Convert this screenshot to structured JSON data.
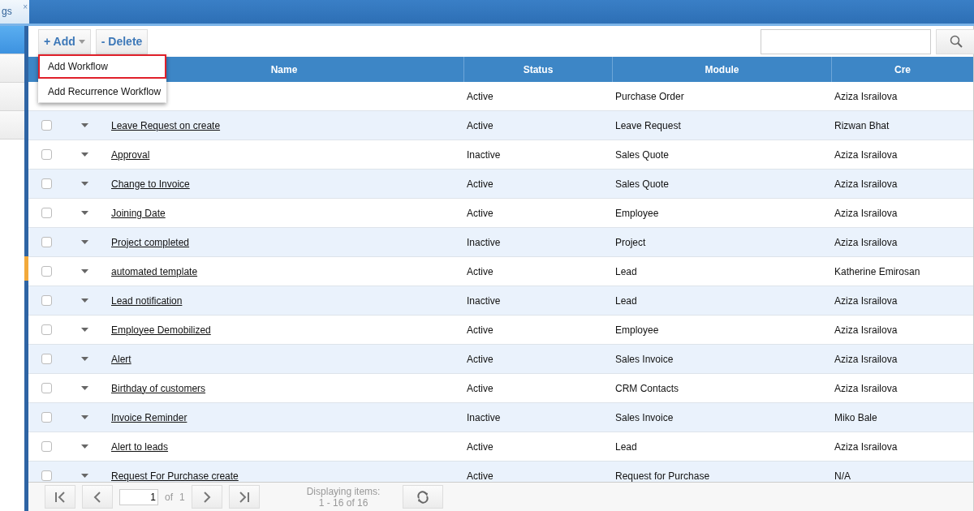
{
  "tab": {
    "label": "gs",
    "close": "×"
  },
  "sidebar": {
    "items": [
      {
        "selected": true
      },
      {
        "selected": false
      },
      {
        "selected": false
      },
      {
        "selected": false
      }
    ]
  },
  "toolbar": {
    "add": "+ Add",
    "delete": "- Delete"
  },
  "menu": [
    {
      "label": "Add Workflow",
      "highlighted": true
    },
    {
      "label": "Add Recurrence Workflow",
      "highlighted": false
    }
  ],
  "table": {
    "columns": [
      "Name",
      "Status",
      "Module",
      "Cre"
    ],
    "rows": [
      {
        "status": "Active",
        "module": "Purchase Order",
        "creator": "Aziza Israilova"
      },
      {
        "name": "Leave Request on create",
        "status": "Active",
        "module": "Leave Request",
        "creator": "Rizwan Bhat",
        "checked": false
      },
      {
        "name": "Approval",
        "status": "Inactive",
        "module": "Sales Quote",
        "creator": "Aziza Israilova",
        "checked": false
      },
      {
        "name": "Change to Invoice",
        "status": "Active",
        "module": "Sales Quote",
        "creator": "Aziza Israilova",
        "checked": false
      },
      {
        "name": "Joining Date",
        "status": "Active",
        "module": "Employee",
        "creator": "Aziza Israilova",
        "checked": false
      },
      {
        "name": "Project completed",
        "status": "Inactive",
        "module": "Project",
        "creator": "Aziza Israilova",
        "checked": false
      },
      {
        "name": "automated template",
        "status": "Active",
        "module": "Lead",
        "creator": "Katherine Emirosan",
        "checked": false
      },
      {
        "name": "Lead notification",
        "status": "Inactive",
        "module": "Lead",
        "creator": "Aziza Israilova",
        "checked": false
      },
      {
        "name": "Employee Demobilized",
        "status": "Active",
        "module": "Employee",
        "creator": "Aziza Israilova",
        "checked": false
      },
      {
        "name": "Alert",
        "status": "Active",
        "module": "Sales Invoice",
        "creator": "Aziza Israilova",
        "checked": false
      },
      {
        "name": "Birthday of customers",
        "status": "Active",
        "module": "CRM Contacts",
        "creator": "Aziza Israilova",
        "checked": false
      },
      {
        "name": "Invoice Reminder",
        "status": "Inactive",
        "module": "Sales Invoice",
        "creator": "Miko Bale",
        "checked": false
      },
      {
        "name": "Alert to leads",
        "status": "Active",
        "module": "Lead",
        "creator": "Aziza Israilova",
        "checked": false
      },
      {
        "name": "Request For Purchase create",
        "status": "Active",
        "module": "Request for Purchase",
        "creator": "N/A",
        "checked": false
      }
    ]
  },
  "pager": {
    "page": "1",
    "of": "of",
    "total": "1",
    "display_label": "Displaying items:",
    "display_range": "1 - 16 of 16"
  }
}
